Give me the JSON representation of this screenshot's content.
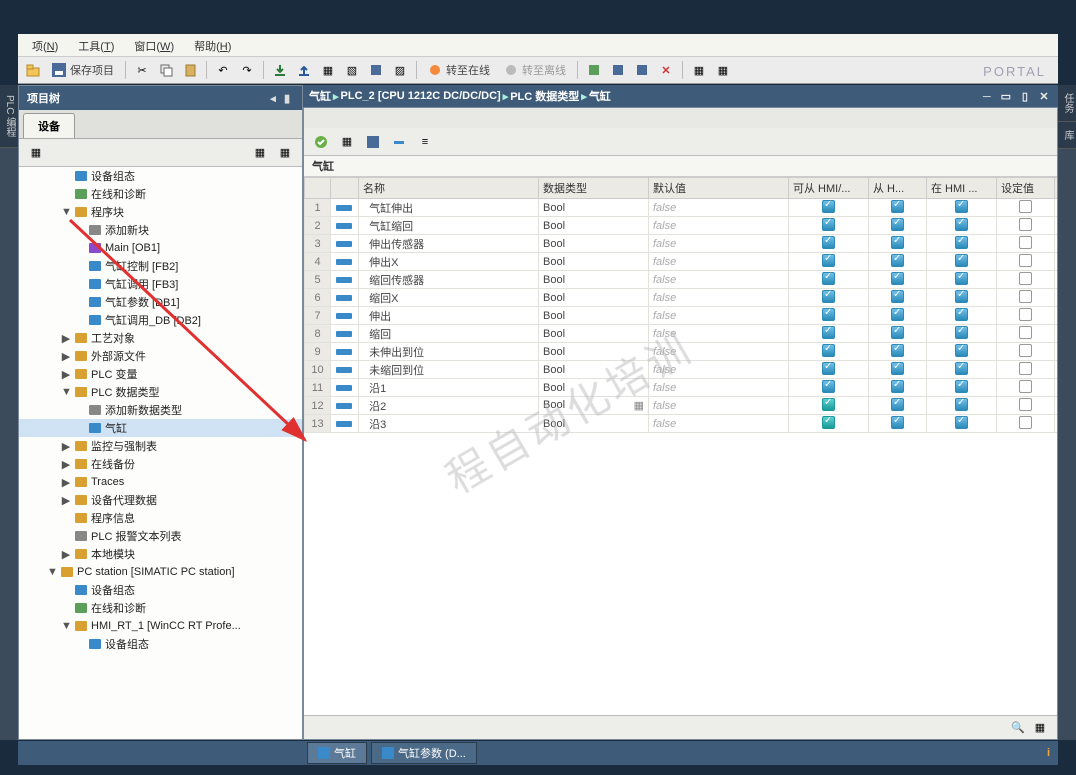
{
  "menu": {
    "items": [
      {
        "l": "项",
        "u": "N"
      },
      {
        "l": "工具",
        "u": "T"
      },
      {
        "l": "窗口",
        "u": "W"
      },
      {
        "l": "帮助",
        "u": "H"
      }
    ]
  },
  "toolbar": {
    "save": "保存项目",
    "go_online": "转至在线",
    "go_offline": "转至离线",
    "portal": "PORTAL"
  },
  "left_strip": {
    "label": "PLC 编程"
  },
  "right_strip": {
    "tabs": [
      "任务",
      "库"
    ]
  },
  "tree": {
    "title": "项目树",
    "device_tab": "设备",
    "items": [
      {
        "ind": 3,
        "tri": "",
        "ic": "dev",
        "t": "设备组态"
      },
      {
        "ind": 3,
        "tri": "",
        "ic": "diag",
        "t": "在线和诊断"
      },
      {
        "ind": 3,
        "tri": "▼",
        "ic": "fld",
        "t": "程序块"
      },
      {
        "ind": 4,
        "tri": "",
        "ic": "add",
        "t": "添加新块"
      },
      {
        "ind": 4,
        "tri": "",
        "ic": "ob",
        "t": "Main [OB1]"
      },
      {
        "ind": 4,
        "tri": "",
        "ic": "fb",
        "t": "气缸控制 [FB2]"
      },
      {
        "ind": 4,
        "tri": "",
        "ic": "fb",
        "t": "气缸调用 [FB3]"
      },
      {
        "ind": 4,
        "tri": "",
        "ic": "db",
        "t": "气缸参数 [DB1]"
      },
      {
        "ind": 4,
        "tri": "",
        "ic": "db",
        "t": "气缸调用_DB [DB2]"
      },
      {
        "ind": 3,
        "tri": "▶",
        "ic": "fld",
        "t": "工艺对象"
      },
      {
        "ind": 3,
        "tri": "▶",
        "ic": "fld",
        "t": "外部源文件"
      },
      {
        "ind": 3,
        "tri": "▶",
        "ic": "fld",
        "t": "PLC 变量"
      },
      {
        "ind": 3,
        "tri": "▼",
        "ic": "fld",
        "t": "PLC 数据类型"
      },
      {
        "ind": 4,
        "tri": "",
        "ic": "add",
        "t": "添加新数据类型"
      },
      {
        "ind": 4,
        "tri": "",
        "ic": "udt",
        "t": "气缸",
        "sel": true
      },
      {
        "ind": 3,
        "tri": "▶",
        "ic": "fld",
        "t": "监控与强制表"
      },
      {
        "ind": 3,
        "tri": "▶",
        "ic": "fld",
        "t": "在线备份"
      },
      {
        "ind": 3,
        "tri": "▶",
        "ic": "fld",
        "t": "Traces"
      },
      {
        "ind": 3,
        "tri": "▶",
        "ic": "fld",
        "t": "设备代理数据"
      },
      {
        "ind": 3,
        "tri": "",
        "ic": "info",
        "t": "程序信息"
      },
      {
        "ind": 3,
        "tri": "",
        "ic": "txt",
        "t": "PLC 报警文本列表"
      },
      {
        "ind": 3,
        "tri": "▶",
        "ic": "fld",
        "t": "本地模块"
      },
      {
        "ind": 2,
        "tri": "▼",
        "ic": "pc",
        "t": "PC station [SIMATIC PC station]"
      },
      {
        "ind": 3,
        "tri": "",
        "ic": "dev",
        "t": "设备组态"
      },
      {
        "ind": 3,
        "tri": "",
        "ic": "diag",
        "t": "在线和诊断"
      },
      {
        "ind": 3,
        "tri": "▼",
        "ic": "hmi",
        "t": "HMI_RT_1 [WinCC RT Profe..."
      },
      {
        "ind": 4,
        "tri": "",
        "ic": "dev",
        "t": "设备组态"
      }
    ]
  },
  "crumb": {
    "parts": [
      "气缸",
      "PLC_2 [CPU 1212C DC/DC/DC]",
      "PLC 数据类型",
      "气缸"
    ]
  },
  "editor": {
    "title": "气缸",
    "cols": [
      "",
      "",
      "名称",
      "数据类型",
      "默认值",
      "可从 HMI/...",
      "从 H...",
      "在 HMI ...",
      "设定值",
      ""
    ],
    "rows": [
      {
        "n": 1,
        "name": "气缸伸出",
        "dt": "Bool",
        "def": "false",
        "c1": true,
        "c2": true,
        "c3": true,
        "c4": false
      },
      {
        "n": 2,
        "name": "气缸缩回",
        "dt": "Bool",
        "def": "false",
        "c1": true,
        "c2": true,
        "c3": true,
        "c4": false
      },
      {
        "n": 3,
        "name": "伸出传感器",
        "dt": "Bool",
        "def": "false",
        "c1": true,
        "c2": true,
        "c3": true,
        "c4": false
      },
      {
        "n": 4,
        "name": "伸出X",
        "dt": "Bool",
        "def": "false",
        "c1": true,
        "c2": true,
        "c3": true,
        "c4": false
      },
      {
        "n": 5,
        "name": "缩回传感器",
        "dt": "Bool",
        "def": "false",
        "c1": true,
        "c2": true,
        "c3": true,
        "c4": false
      },
      {
        "n": 6,
        "name": "缩回X",
        "dt": "Bool",
        "def": "false",
        "c1": true,
        "c2": true,
        "c3": true,
        "c4": false
      },
      {
        "n": 7,
        "name": "伸出",
        "dt": "Bool",
        "def": "false",
        "c1": true,
        "c2": true,
        "c3": true,
        "c4": false
      },
      {
        "n": 8,
        "name": "缩回",
        "dt": "Bool",
        "def": "false",
        "c1": true,
        "c2": true,
        "c3": true,
        "c4": false
      },
      {
        "n": 9,
        "name": "未伸出到位",
        "dt": "Bool",
        "def": "false",
        "c1": true,
        "c2": true,
        "c3": true,
        "c4": false
      },
      {
        "n": 10,
        "name": "未缩回到位",
        "dt": "Bool",
        "def": "false",
        "c1": true,
        "c2": true,
        "c3": true,
        "c4": false
      },
      {
        "n": 11,
        "name": "沿1",
        "dt": "Bool",
        "def": "false",
        "c1": true,
        "c2": true,
        "c3": true,
        "c4": false
      },
      {
        "n": 12,
        "name": "沿2",
        "dt": "Bool",
        "def": "false",
        "c1": "teal",
        "c2": true,
        "c3": true,
        "c4": false,
        "dd": true
      },
      {
        "n": 13,
        "name": "沿3",
        "dt": "Bool",
        "def": "false",
        "c1": "teal",
        "c2": true,
        "c3": true,
        "c4": false
      }
    ]
  },
  "taskbar": {
    "tabs": [
      "气缸",
      "气缸参数 (D..."
    ]
  },
  "watermark": "程自动化培训"
}
